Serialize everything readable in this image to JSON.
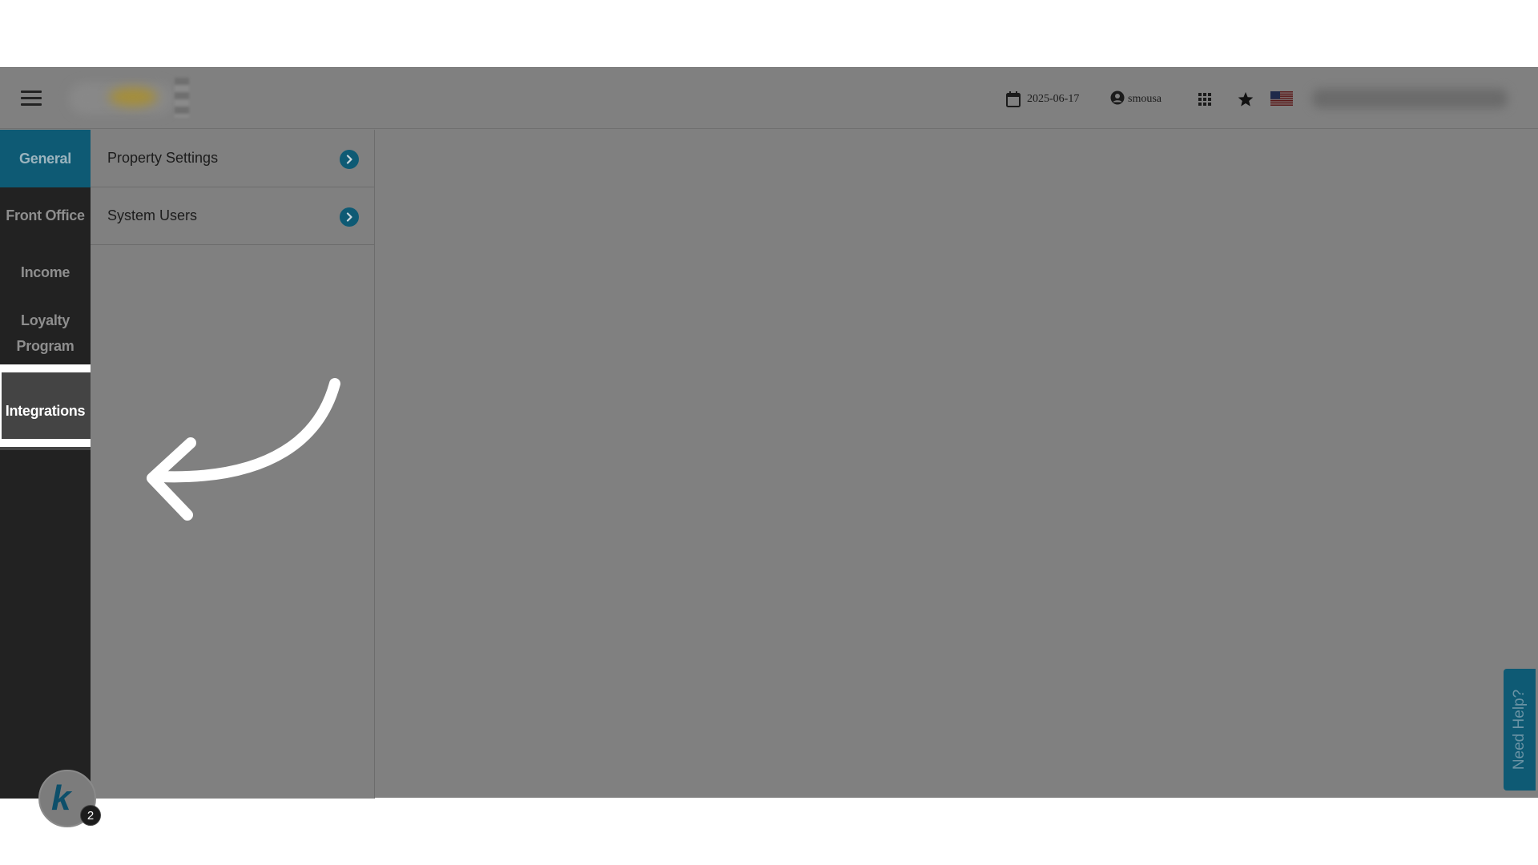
{
  "header": {
    "menu_icon": "hamburger-menu-icon",
    "logo": "company-logo",
    "date": "2025-06-17",
    "date_icon": "calendar-icon",
    "username": "smousa",
    "user_icon": "user-circle-icon",
    "apps_icon": "grid-apps-icon",
    "favorites_icon": "star-icon",
    "language_icon": "us-flag-icon",
    "hotel_name_blurred": true
  },
  "rail": {
    "items": [
      {
        "label": "General",
        "state": "active"
      },
      {
        "label": "Front Office",
        "state": "normal"
      },
      {
        "label": "Income",
        "state": "normal"
      },
      {
        "label": "Loyalty Program",
        "state": "normal"
      },
      {
        "label": "Integrations",
        "state": "selected"
      }
    ]
  },
  "submenu": {
    "items": [
      {
        "label": "Property Settings",
        "icon": "chevron-right-circle-icon"
      },
      {
        "label": "System Users",
        "icon": "chevron-right-circle-icon"
      }
    ]
  },
  "widget": {
    "letter": "k",
    "badge_count": "2"
  },
  "help": {
    "label": "Need Help?"
  },
  "colors": {
    "accent": "#0e5a74",
    "rail_bg": "#222222",
    "overlay_gray": "#808080"
  }
}
